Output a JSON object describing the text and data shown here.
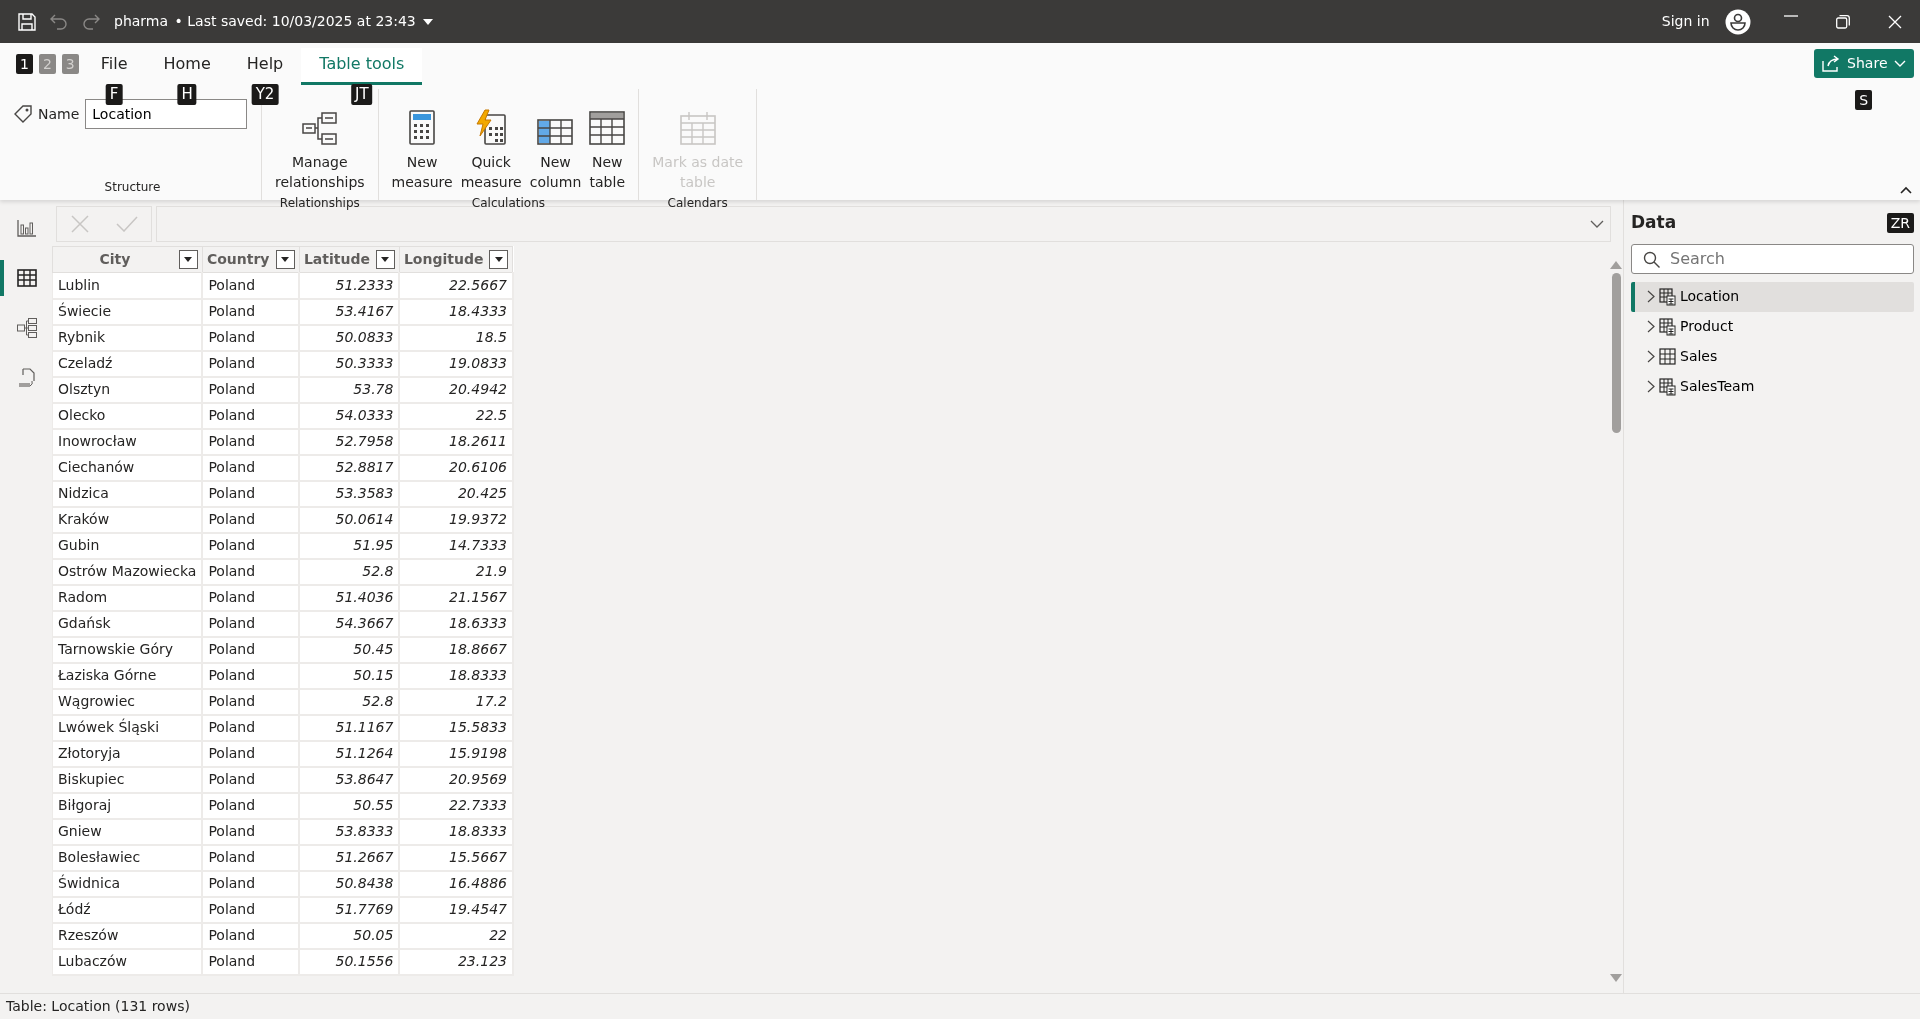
{
  "title_bar": {
    "file_name": "pharma",
    "saved": "• Last saved: 10/03/2025 at 23:43",
    "sign_in": "Sign in"
  },
  "quick_keytips": [
    {
      "label": "1",
      "disabled": false
    },
    {
      "label": "2",
      "disabled": true
    },
    {
      "label": "3",
      "disabled": true
    }
  ],
  "tabs": [
    {
      "label": "File",
      "keytip": "F",
      "selected": false
    },
    {
      "label": "Home",
      "keytip": "H",
      "selected": false
    },
    {
      "label": "Help",
      "keytip": "Y2",
      "selected": false
    },
    {
      "label": "Table tools",
      "keytip": "JT",
      "selected": true
    }
  ],
  "share": {
    "label": "Share",
    "keytip": "S"
  },
  "groups": [
    {
      "title": "Structure",
      "kind": "name",
      "label": "Name",
      "value": "Location"
    },
    {
      "title": "Relationships",
      "kind": "buttons",
      "buttons": [
        {
          "label": "Manage relationships",
          "disabled": false
        }
      ]
    },
    {
      "title": "Calculations",
      "kind": "buttons",
      "buttons": [
        {
          "label": "New measure",
          "disabled": false
        },
        {
          "label": "Quick measure",
          "disabled": false
        },
        {
          "label": "New column",
          "disabled": false
        },
        {
          "label": "New table",
          "disabled": false
        }
      ]
    },
    {
      "title": "Calendars",
      "kind": "buttons",
      "buttons": [
        {
          "label": "Mark as date table",
          "disabled": true
        }
      ]
    }
  ],
  "nav": [
    {
      "selected": false
    },
    {
      "selected": true
    },
    {
      "selected": false
    },
    {
      "selected": false
    }
  ],
  "table": {
    "columns": [
      "City",
      "Country",
      "Latitude",
      "Longitude"
    ],
    "rows": [
      [
        "Lublin",
        "Poland",
        "51.2333",
        "22.5667"
      ],
      [
        "Świecie",
        "Poland",
        "53.4167",
        "18.4333"
      ],
      [
        "Rybnik",
        "Poland",
        "50.0833",
        "18.5"
      ],
      [
        "Czeladź",
        "Poland",
        "50.3333",
        "19.0833"
      ],
      [
        "Olsztyn",
        "Poland",
        "53.78",
        "20.4942"
      ],
      [
        "Olecko",
        "Poland",
        "54.0333",
        "22.5"
      ],
      [
        "Inowrocław",
        "Poland",
        "52.7958",
        "18.2611"
      ],
      [
        "Ciechanów",
        "Poland",
        "52.8817",
        "20.6106"
      ],
      [
        "Nidzica",
        "Poland",
        "53.3583",
        "20.425"
      ],
      [
        "Kraków",
        "Poland",
        "50.0614",
        "19.9372"
      ],
      [
        "Gubin",
        "Poland",
        "51.95",
        "14.7333"
      ],
      [
        "Ostrów Mazowiecka",
        "Poland",
        "52.8",
        "21.9"
      ],
      [
        "Radom",
        "Poland",
        "51.4036",
        "21.1567"
      ],
      [
        "Gdańsk",
        "Poland",
        "54.3667",
        "18.6333"
      ],
      [
        "Tarnowskie Góry",
        "Poland",
        "50.45",
        "18.8667"
      ],
      [
        "Łaziska Górne",
        "Poland",
        "50.15",
        "18.8333"
      ],
      [
        "Wągrowiec",
        "Poland",
        "52.8",
        "17.2"
      ],
      [
        "Lwówek Śląski",
        "Poland",
        "51.1167",
        "15.5833"
      ],
      [
        "Złotoryja",
        "Poland",
        "51.1264",
        "15.9198"
      ],
      [
        "Biskupiec",
        "Poland",
        "53.8647",
        "20.9569"
      ],
      [
        "Biłgoraj",
        "Poland",
        "50.55",
        "22.7333"
      ],
      [
        "Gniew",
        "Poland",
        "53.8333",
        "18.8333"
      ],
      [
        "Bolesławiec",
        "Poland",
        "51.2667",
        "15.5667"
      ],
      [
        "Świdnica",
        "Poland",
        "50.8438",
        "16.4886"
      ],
      [
        "Łódź",
        "Poland",
        "51.7769",
        "19.4547"
      ],
      [
        "Rzeszów",
        "Poland",
        "50.05",
        "22"
      ],
      [
        "Lubaczów",
        "Poland",
        "50.1556",
        "23.123"
      ]
    ]
  },
  "data_pane": {
    "title": "Data",
    "keytip": "ZR",
    "search_placeholder": "Search",
    "items": [
      {
        "label": "Location",
        "selected": true
      },
      {
        "label": "Product",
        "selected": false
      },
      {
        "label": "Sales",
        "selected": false
      },
      {
        "label": "SalesTeam",
        "selected": false
      }
    ]
  },
  "status_bar": "Table: Location (131 rows)"
}
